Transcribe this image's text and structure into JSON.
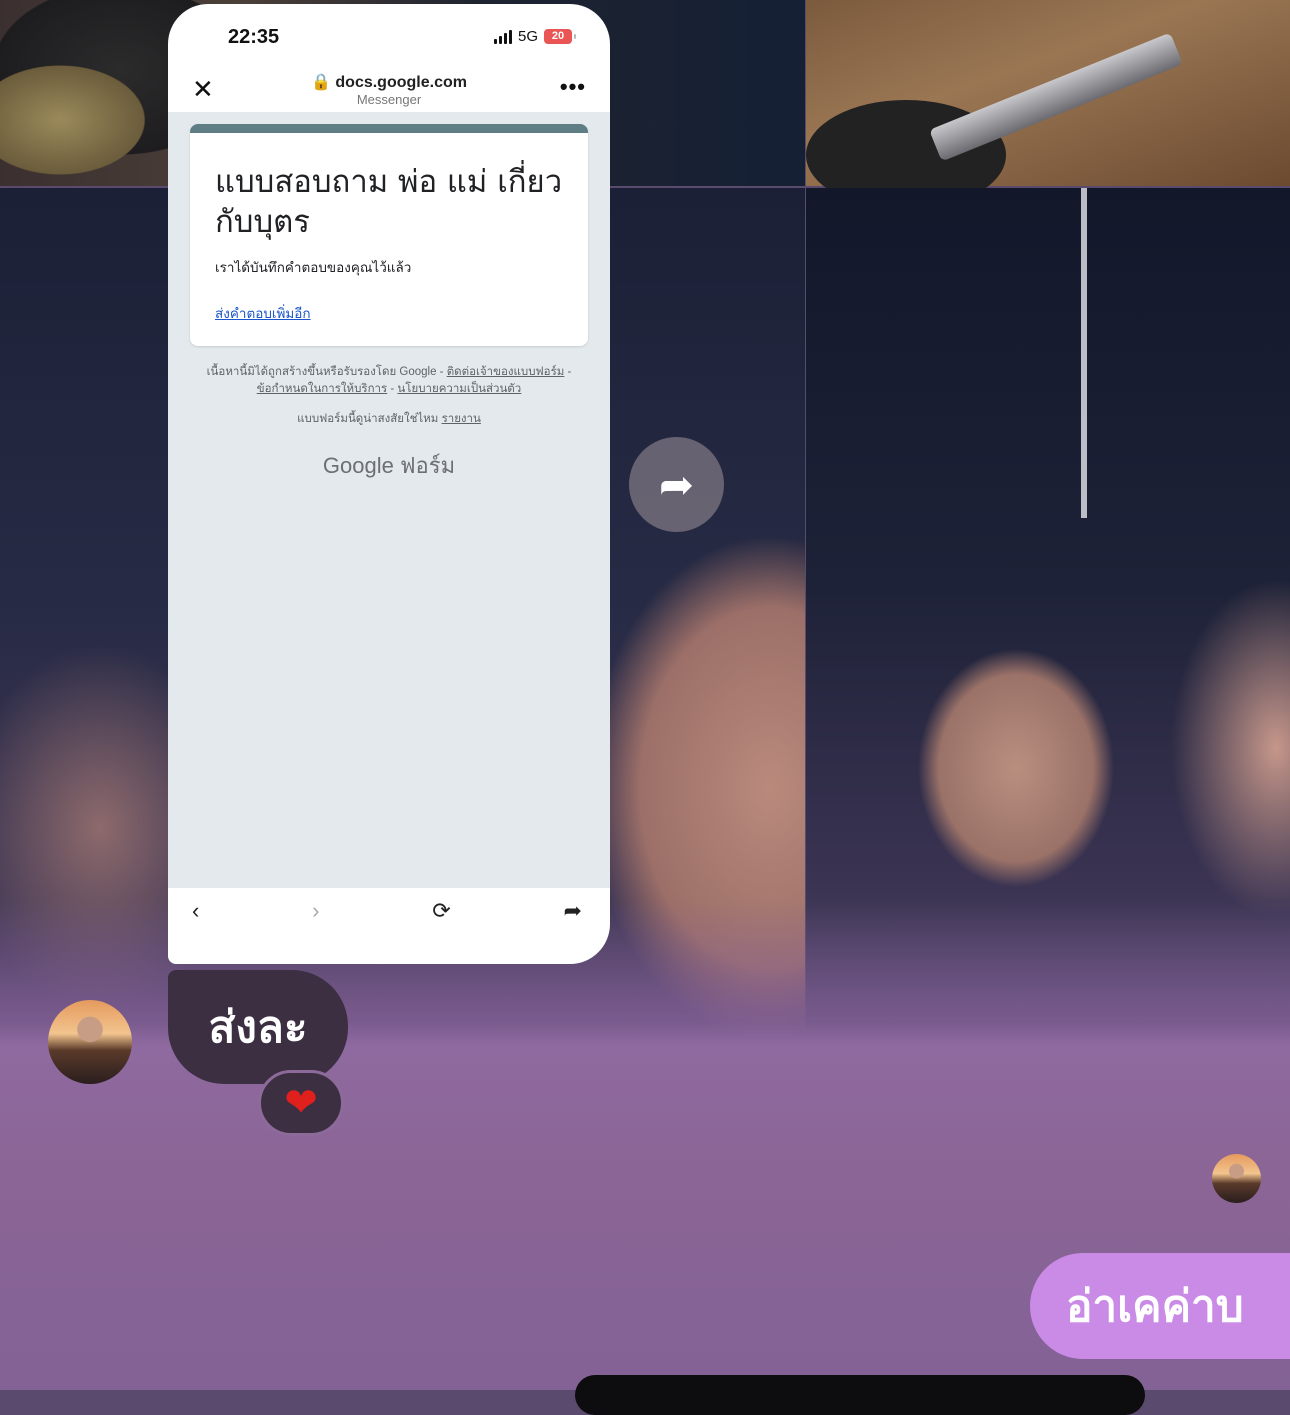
{
  "shared_screenshot": {
    "status_bar": {
      "time": "22:35",
      "network": "5G",
      "battery": "20"
    },
    "browser": {
      "host": "docs.google.com",
      "subtitle": "Messenger",
      "close_icon": "close-icon",
      "more_icon": "more-icon"
    },
    "form": {
      "title": "แบบสอบถาม พ่อ แม่ เกี่ยวกับบุตร",
      "confirmation": "เราได้บันทึกคำตอบของคุณไว้แล้ว",
      "submit_another": "ส่งคำตอบเพิ่มอีก",
      "legal_text": "เนื้อหานี้มิได้ถูกสร้างขึ้นหรือรับรองโดย Google -",
      "contact_owner": "ติดต่อเจ้าของแบบฟอร์ม",
      "terms": "ข้อกำหนดในการให้บริการ",
      "privacy": "นโยบายความเป็นส่วนตัว",
      "suspicious": "แบบฟอร์มนี้ดูน่าสงสัยใช่ไหม",
      "report": "รายงาน",
      "brand": "Google ฟอร์ม"
    },
    "nav_icons": [
      "back-icon",
      "forward-icon",
      "reload-icon",
      "share-icon"
    ]
  },
  "messages": {
    "incoming": {
      "text": "ส่งละ",
      "reaction": "❤"
    },
    "outgoing": {
      "text": "อ่าเคค่าบ"
    }
  },
  "colors": {
    "incoming_bubble": "#3d2f42",
    "outgoing_bubble": "#c98be6",
    "form_accent": "#5e7d85",
    "link": "#1a55c9"
  }
}
